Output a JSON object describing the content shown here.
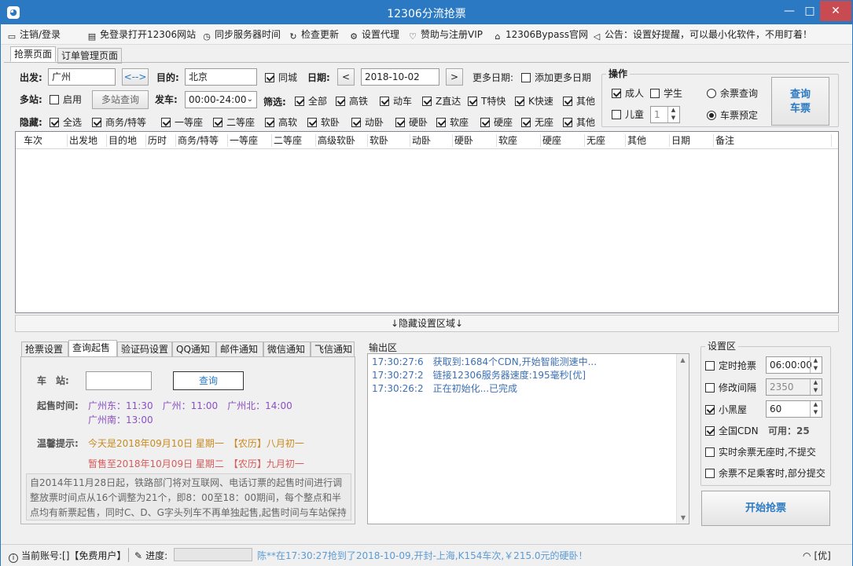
{
  "window": {
    "title": "12306分流抢票",
    "minimize": "—",
    "maximize": "□",
    "close": "✕"
  },
  "menu": [
    {
      "icon": "terminal-icon",
      "label": "注销/登录"
    },
    {
      "icon": "browser-icon",
      "label": "免登录打开12306网站"
    },
    {
      "icon": "clock-icon",
      "label": "同步服务器时间"
    },
    {
      "icon": "refresh-icon",
      "label": "检查更新"
    },
    {
      "icon": "gear-icon",
      "label": "设置代理"
    },
    {
      "icon": "heart-icon",
      "label": "赞助与注册VIP"
    },
    {
      "icon": "home-icon",
      "label": "12306Bypass官网"
    },
    {
      "icon": "speaker-icon",
      "label": "公告：设置好提醒，可以最小化软件，不用盯着！"
    }
  ],
  "tabs": {
    "main": [
      "抢票页面",
      "订单管理页面"
    ]
  },
  "query": {
    "from_label": "出发:",
    "from_value": "广州",
    "swap_label": "<-->",
    "to_label": "目的:",
    "to_value": "北京",
    "same_city": "同城",
    "date_label": "日期:",
    "date_prev": "<",
    "date_value": "2018-10-02",
    "date_next": ">",
    "more_dates_label": "更多日期:",
    "add_more_dates": "添加更多日期",
    "multi_station_label": "多站:",
    "multi_enable": "启用",
    "multi_query_btn": "多站查询",
    "depart_label": "发车:",
    "depart_value": "00:00-24:00",
    "filter_label": "筛选:",
    "filters": [
      "全部",
      "高铁",
      "动车",
      "Z直达",
      "T特快",
      "K快速",
      "其他"
    ],
    "hide_label": "隐藏:",
    "hides": [
      "全选",
      "商务/特等",
      "一等座",
      "二等座",
      "高软",
      "软卧",
      "动卧",
      "硬卧",
      "软座",
      "硬座",
      "无座",
      "其他"
    ]
  },
  "ops": {
    "title": "操作",
    "adult": "成人",
    "student": "学生",
    "child": "儿童",
    "child_count": "1",
    "remain_query": "余票查询",
    "ticket_reserve": "车票预定",
    "query_btn_line1": "查询",
    "query_btn_line2": "车票"
  },
  "grid": {
    "columns": [
      "车次",
      "出发地",
      "目的地",
      "历时",
      "商务/特等",
      "一等座",
      "二等座",
      "高级软卧",
      "软卧",
      "动卧",
      "硬卧",
      "软座",
      "硬座",
      "无座",
      "其他",
      "日期",
      "备注"
    ]
  },
  "hide_settings": "↓隐藏设置区域↓",
  "bottom_tabs": [
    "抢票设置",
    "查询起售",
    "验证码设置",
    "QQ通知",
    "邮件通知",
    "微信通知",
    "飞信通知"
  ],
  "sale": {
    "station_label": "车　站:",
    "station_value": "",
    "query_btn": "查询",
    "time_label": "起售时间:",
    "times_line1": "广州东：11:30　广州：11:00　广州北：14:00",
    "times_line2": "广州南：13:00",
    "tips_label": "温馨提示:",
    "tip1": "今天是2018年09月10日 星期一　【农历】八月初一",
    "tip2": "暂售至2018年10月09日 星期二　【农历】九月初一",
    "notice": "自2014年11月28日起，铁路部门将对互联网、电话订票的起售时间进行调整放票时间点从16个调整为21个，即8：00至18：00期间，每个整点和半点均有新票起售，同时C、D、G字头列车不再单独起售,起售时间与车站保持一致"
  },
  "output": {
    "title": "输出区",
    "lines": [
      "17:30:27:6　获取到:1684个CDN,开始智能测速中...",
      "17:30:27:2　链接12306服务器速度:195毫秒[优]",
      "17:30:26:2　正在初始化...已完成"
    ]
  },
  "settings": {
    "title": "设置区",
    "timed": "定时抢票",
    "timed_value": "06:00:00",
    "interval": "修改间隔",
    "interval_value": "2350",
    "blackroom": "小黑屋",
    "blackroom_value": "60",
    "cdn": "全国CDN",
    "cdn_avail_label": "可用：",
    "cdn_avail": "25",
    "realtime": "实时余票无座时,不提交",
    "partial": "余票不足乘客时,部分提交",
    "start_btn": "开始抢票"
  },
  "status": {
    "account": "当前账号:[]【免费用户】",
    "progress_label": "进度:",
    "progress": 0,
    "ticker": "陈**在17:30:27抢到了2018-10-09,开封-上海,K154车次,￥215.0元的硬卧！",
    "net": "[优]"
  }
}
